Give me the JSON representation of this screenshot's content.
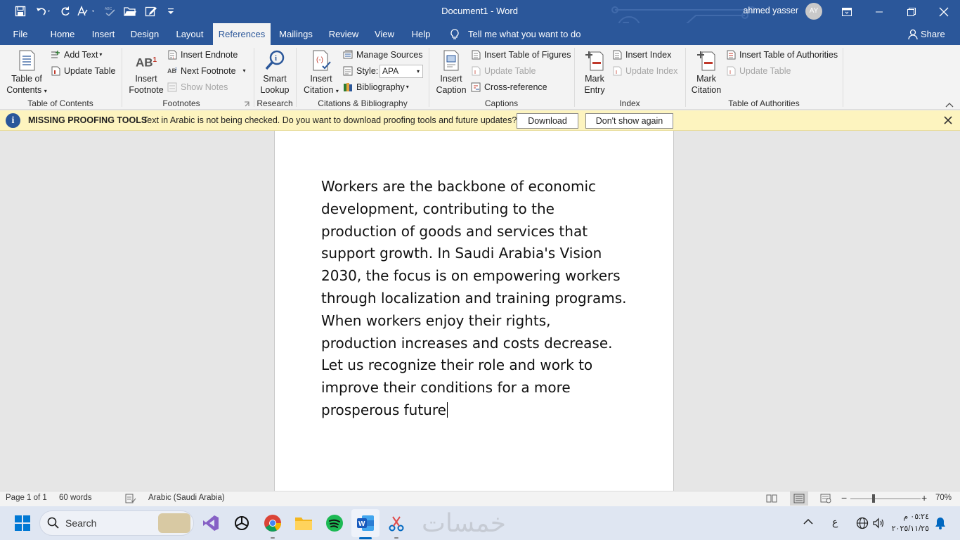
{
  "titlebar": {
    "doc_title": "Document1  -  Word",
    "user_name": "ahmed yasser",
    "user_initials": "AY"
  },
  "tabs": [
    {
      "label": "File"
    },
    {
      "label": "Home"
    },
    {
      "label": "Insert"
    },
    {
      "label": "Design"
    },
    {
      "label": "Layout"
    },
    {
      "label": "References"
    },
    {
      "label": "Mailings"
    },
    {
      "label": "Review"
    },
    {
      "label": "View"
    },
    {
      "label": "Help"
    }
  ],
  "tell_me": "Tell me what you want to do",
  "share": "Share",
  "ribbon": {
    "toc": {
      "big_line1": "Table of",
      "big_line2": "Contents",
      "add_text": "Add Text",
      "update_table": "Update Table",
      "group": "Table of Contents"
    },
    "footnotes": {
      "big_line1": "Insert",
      "big_line2": "Footnote",
      "ab_mark": "AB",
      "sup": "1",
      "insert_endnote": "Insert Endnote",
      "next_footnote": "Next Footnote",
      "show_notes": "Show Notes",
      "group": "Footnotes"
    },
    "research": {
      "big_line1": "Smart",
      "big_line2": "Lookup",
      "group": "Research"
    },
    "citations": {
      "big_line1": "Insert",
      "big_line2": "Citation",
      "manage_sources": "Manage Sources",
      "style_label": "Style:",
      "style_value": "APA",
      "bibliography": "Bibliography",
      "group": "Citations & Bibliography"
    },
    "captions": {
      "big_line1": "Insert",
      "big_line2": "Caption",
      "insert_tof": "Insert Table of Figures",
      "update_table": "Update Table",
      "cross_reference": "Cross-reference",
      "group": "Captions"
    },
    "index": {
      "big_line1": "Mark",
      "big_line2": "Entry",
      "insert_index": "Insert Index",
      "update_index": "Update Index",
      "group": "Index"
    },
    "toa": {
      "big_line1": "Mark",
      "big_line2": "Citation",
      "insert_toa": "Insert Table of Authorities",
      "update_table": "Update Table",
      "group": "Table of Authorities"
    }
  },
  "message_bar": {
    "title": "MISSING PROOFING TOOLS",
    "text": "Text in Arabic is not being checked. Do you want to download proofing tools and future updates?",
    "download": "Download",
    "dont_show": "Don't show again"
  },
  "document": {
    "text": "Workers are the backbone of economic\ndevelopment, contributing to the\nproduction of goods and services that\nsupport growth. In Saudi Arabia's Vision\n2030, the focus is on empowering workers\nthrough localization and training programs.\nWhen workers enjoy their rights,\nproduction increases and costs decrease.\nLet us recognize their role and work to\nimprove their conditions for a more\nprosperous future"
  },
  "statusbar": {
    "page": "Page 1 of 1",
    "words": "60 words",
    "language": "Arabic (Saudi Arabia)",
    "zoom": "70%",
    "zoom_level_percent": 70
  },
  "taskbar": {
    "search_placeholder": "Search",
    "watermark": "خمسات",
    "time": "٠٥:٢٤ م",
    "date": "٢٠٢٥/١١/٢٥",
    "ime": "ع"
  },
  "colors": {
    "word_blue": "#2b579a",
    "ribbon_bg": "#f3f3f3",
    "message_bar_bg": "#fdf4bf",
    "taskbar_bg": "#dfe6f2"
  }
}
